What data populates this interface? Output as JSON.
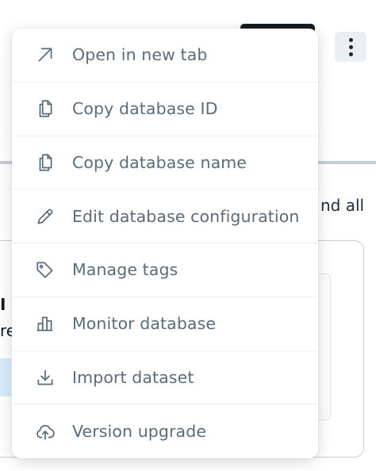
{
  "background": {
    "partial_text_right": "nd all",
    "partial_text_left_1": "I r",
    "partial_text_left_2": "re"
  },
  "menu": {
    "items": [
      {
        "label": "Open in new tab",
        "icon": "arrow-up-right-icon"
      },
      {
        "label": "Copy database ID",
        "icon": "copy-icon"
      },
      {
        "label": "Copy database name",
        "icon": "copy-icon"
      },
      {
        "label": "Edit database configuration",
        "icon": "pencil-icon"
      },
      {
        "label": "Manage tags",
        "icon": "tag-icon"
      },
      {
        "label": "Monitor database",
        "icon": "bar-chart-icon"
      },
      {
        "label": "Import dataset",
        "icon": "download-icon"
      },
      {
        "label": "Version upgrade",
        "icon": "cloud-upload-icon"
      }
    ]
  }
}
